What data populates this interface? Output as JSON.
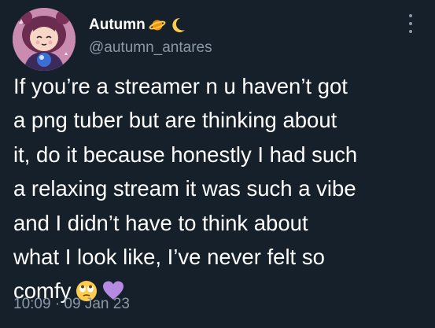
{
  "author": {
    "display_name": "Autumn",
    "handle": "@autumn_antares",
    "name_icons": [
      "ringed-planet-icon",
      "crescent-moon-icon"
    ]
  },
  "tweet": {
    "lines": [
      "If you’re a streamer n u haven’t got",
      "a png tuber but are thinking about",
      "it, do it because honestly I had such",
      "a relaxing stream it was such a vibe",
      "and I didn’t have to think about",
      "what I look like, I’ve never felt so",
      "comfy"
    ],
    "trailing_icons": [
      "face-with-rolling-eyes-icon",
      "purple-heart-icon"
    ]
  },
  "meta": {
    "timestamp": "10:09 · 09 Jan 23"
  },
  "colors": {
    "background": "#15202b",
    "primary_text": "#ffffff",
    "secondary_text": "#8b98a5",
    "heart": "#b48be0"
  }
}
